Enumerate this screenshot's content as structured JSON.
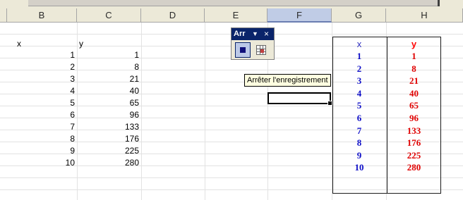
{
  "columns": [
    "B",
    "C",
    "D",
    "E",
    "F",
    "G",
    "H"
  ],
  "selected_column": "F",
  "left_table": {
    "header_x": "x",
    "header_y": "y",
    "x": [
      "1",
      "2",
      "3",
      "4",
      "5",
      "6",
      "7",
      "8",
      "9",
      "10"
    ],
    "y": [
      "1",
      "8",
      "21",
      "40",
      "65",
      "96",
      "133",
      "176",
      "225",
      "280"
    ]
  },
  "right_table": {
    "header_x": "x",
    "header_y": "y",
    "x": [
      "1",
      "2",
      "3",
      "4",
      "5",
      "6",
      "7",
      "8",
      "9",
      "10"
    ],
    "y": [
      "1",
      "8",
      "21",
      "40",
      "65",
      "96",
      "133",
      "176",
      "225",
      "280"
    ]
  },
  "toolbar": {
    "title": "Arr",
    "menu_glyph": "▼",
    "close_glyph": "×",
    "stop_icon": "stop-recording-icon",
    "relative_icon": "relative-reference-icon"
  },
  "tooltip": {
    "text": "Arrêter l'enregistrement"
  },
  "colors": {
    "header_bg": "#ece9d8",
    "selected_header_bg": "#c0cce6",
    "toolbar_title_bg": "#0a246a",
    "table_x_color": "#1010c8",
    "table_y_color": "#e00000",
    "tooltip_bg": "#ffffe1"
  }
}
